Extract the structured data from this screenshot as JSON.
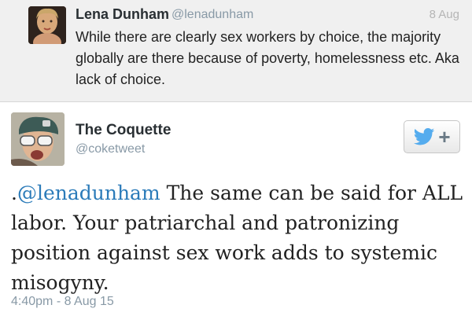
{
  "reply": {
    "name": "Lena Dunham",
    "handle": "@lenadunham",
    "date": "8 Aug",
    "text": "While there are clearly sex workers by choice, the majority globally are there because of poverty, homelessness etc. Aka lack of choice."
  },
  "tweet": {
    "name": "The Coquette",
    "handle": "@coketweet",
    "text_prefix": ".",
    "mention": "@lenadunham",
    "text_body": " The same can be said for ALL labor. Your patriarchal and patronizing position against sex work adds to systemic misogyny.",
    "timestamp": "4:40pm - 8 Aug 15",
    "follow_icon": "twitter-bird-plus-icon"
  },
  "colors": {
    "mention": "#2b7bb9",
    "reply_background": "#f0f0f0",
    "twitter_blue": "#55acee"
  }
}
